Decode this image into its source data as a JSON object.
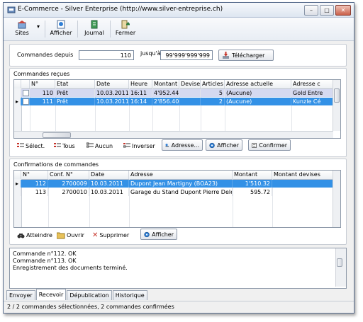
{
  "window": {
    "title": "E-Commerce - Silver Enterprise (http://www.silver-entreprise.ch)"
  },
  "toolbar": {
    "sites": "Sites",
    "afficher": "Afficher",
    "journal": "Journal",
    "fermer": "Fermer"
  },
  "filter": {
    "label": "Commandes depuis",
    "from": "110",
    "to_label": "jusqu'à",
    "to": "99'999'999'999",
    "download": "Télécharger"
  },
  "received": {
    "title": "Commandes reçues",
    "columns": [
      "N°",
      "Etat",
      "Date",
      "Heure",
      "Montant",
      "Devise",
      "Articles",
      "Adresse actuelle",
      "Adresse c"
    ],
    "rows": [
      {
        "num": "110",
        "etat": "Prêt",
        "date": "10.03.2011",
        "heure": "16:11",
        "montant": "4'952.44",
        "devise": "",
        "articles": "5",
        "adresse": "(Aucune)",
        "adresse_c": "Gold Entre"
      },
      {
        "num": "111",
        "etat": "Prêt",
        "date": "10.03.2011",
        "heure": "16:14",
        "montant": "2'856.40",
        "devise": "",
        "articles": "2",
        "adresse": "(Aucune)",
        "adresse_c": "Kunzle Cé"
      }
    ],
    "buttons": {
      "select": "Sélect.",
      "tous": "Tous",
      "aucun": "Aucun",
      "inverser": "Inverser",
      "adresse": "Adresse...",
      "afficher": "Afficher",
      "confirmer": "Confirmer"
    }
  },
  "confirmations": {
    "title": "Confirmations de commandes",
    "columns": [
      "N°",
      "Conf. N°",
      "Date",
      "Adresse",
      "Montant",
      "Montant devises"
    ],
    "rows": [
      {
        "num": "112",
        "conf": "2700009",
        "date": "10.03.2011",
        "adresse": "Dupont Jean Martigny (BOA23)",
        "montant": "1'510.32",
        "devises": ""
      },
      {
        "num": "113",
        "conf": "2700010",
        "date": "10.03.2011",
        "adresse": "Garage du Stand Dupont Pierre Delémor",
        "montant": "595.72",
        "devises": ""
      }
    ],
    "buttons": {
      "atteindre": "Atteindre",
      "ouvrir": "Ouvrir",
      "supprimer": "Supprimer",
      "afficher": "Afficher"
    }
  },
  "log": [
    "Commande n°112. OK",
    "Commande n°113. OK",
    "Enregistrement des documents terminé."
  ],
  "tabs": [
    "Envoyer",
    "Recevoir",
    "Dépublication",
    "Historique"
  ],
  "status": "2 / 2 commandes sélectionnées, 2 commandes confirmées",
  "colors": {
    "selection": "#3391e6",
    "light_selection": "#d5d9f0"
  }
}
